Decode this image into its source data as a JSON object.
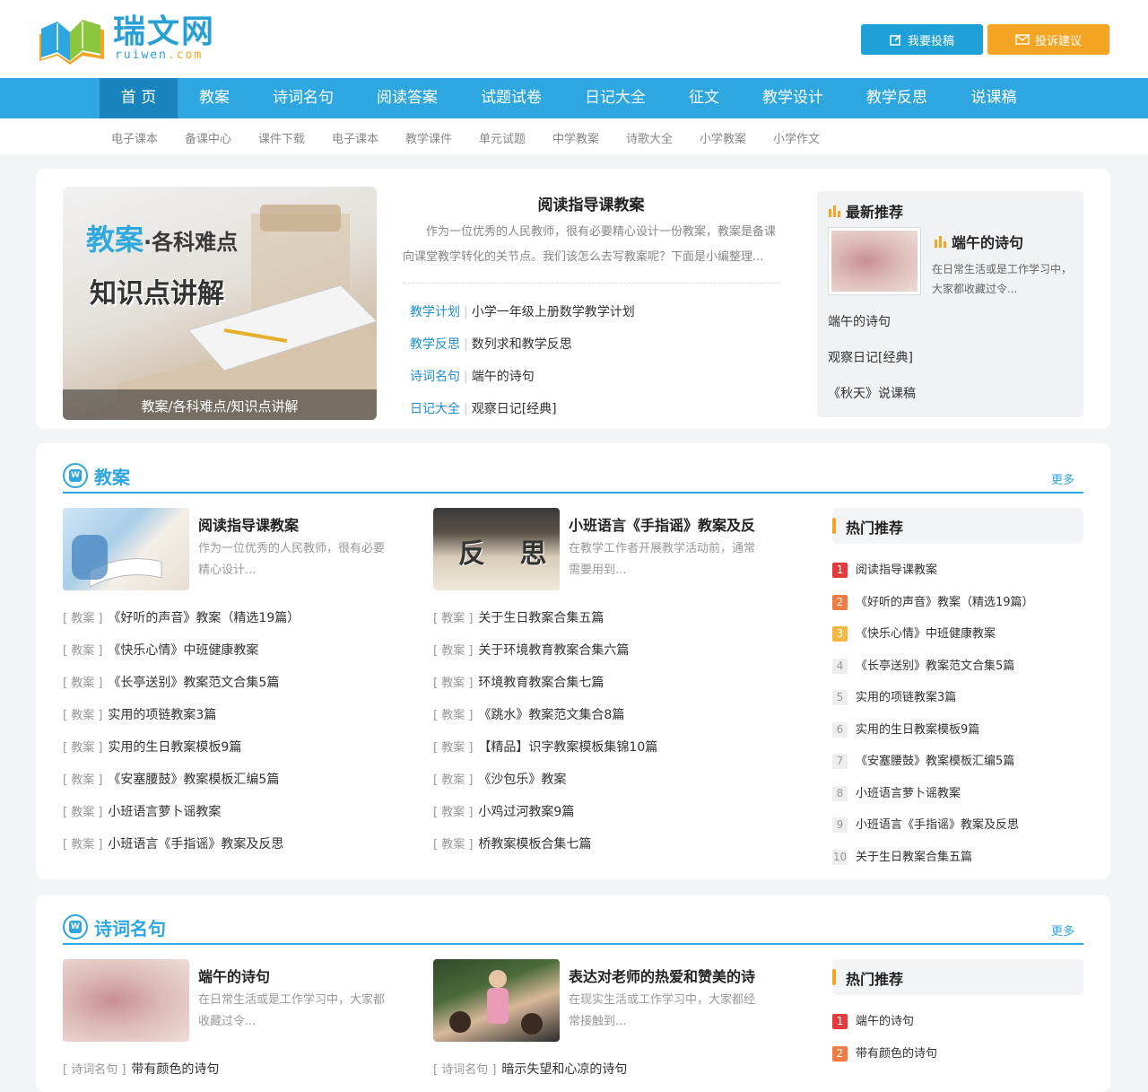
{
  "header": {
    "logo_cn": "瑞文网",
    "logo_en_a": "ruiwen",
    "logo_en_b": ".com",
    "submit_button": "我要投稿",
    "complaint_button": "投诉建议"
  },
  "nav": [
    "首 页",
    "教案",
    "诗词名句",
    "阅读答案",
    "试题试卷",
    "日记大全",
    "征文",
    "教学设计",
    "教学反思",
    "说课稿"
  ],
  "subnav": [
    "电子课本",
    "备课中心",
    "课件下载",
    "电子课本",
    "教学课件",
    "单元试题",
    "中学教案",
    "诗歌大全",
    "小学教案",
    "小学作文"
  ],
  "hero": {
    "img_title_a": "教案",
    "img_title_b": "·各科难点",
    "img_title_c": "知识点讲解",
    "caption": "教案/各科难点/知识点讲解",
    "title": "阅读指导课教案",
    "desc": "作为一位优秀的人民教师，很有必要精心设计一份教案，教案是备课向课堂教学转化的关节点。我们该怎么去写教案呢？下面是小编整理...",
    "links": [
      {
        "cat": "教学计划",
        "title": "小学一年级上册数学教学计划"
      },
      {
        "cat": "教学反思",
        "title": "数列求和教学反思"
      },
      {
        "cat": "诗词名句",
        "title": "端午的诗句"
      },
      {
        "cat": "日记大全",
        "title": "观察日记[经典]"
      }
    ]
  },
  "recommend": {
    "heading": "最新推荐",
    "featured_title": "端午的诗句",
    "featured_desc": "在日常生活或是工作学习中，大家都收藏过令...",
    "links": [
      "端午的诗句",
      "观察日记[经典]",
      "《秋天》说课稿"
    ]
  },
  "section1": {
    "title": "教案",
    "more": "更多",
    "feat1": {
      "title": "阅读指导课教案",
      "desc": "作为一位优秀的人民教师，很有必要精心设计..."
    },
    "feat2": {
      "title": "小班语言《手指谣》教案及反",
      "desc": "在教学工作者开展教学活动前，通常需要用到...",
      "img_text": "反 思"
    },
    "tag": "[ 教案 ]",
    "left": [
      "《好听的声音》教案（精选19篇）",
      "《快乐心情》中班健康教案",
      "《长亭送别》教案范文合集5篇",
      "实用的项链教案3篇",
      "实用的生日教案模板9篇",
      "《安塞腰鼓》教案模板汇编5篇",
      "小班语言萝卜谣教案",
      "小班语言《手指谣》教案及反思"
    ],
    "right": [
      "关于生日教案合集五篇",
      "关于环境教育教案合集六篇",
      "环境教育教案合集七篇",
      "《跳水》教案范文集合8篇",
      "【精品】识字教案模板集锦10篇",
      "《沙包乐》教案",
      "小鸡过河教案9篇",
      "桥教案模板合集七篇"
    ],
    "hot_title": "热门推荐",
    "hot": [
      "阅读指导课教案",
      "《好听的声音》教案（精选19篇）",
      "《快乐心情》中班健康教案",
      "《长亭送别》教案范文合集5篇",
      "实用的项链教案3篇",
      "实用的生日教案模板9篇",
      "《安塞腰鼓》教案模板汇编5篇",
      "小班语言萝卜谣教案",
      "小班语言《手指谣》教案及反思",
      "关于生日教案合集五篇"
    ]
  },
  "section2": {
    "title": "诗词名句",
    "more": "更多",
    "feat1": {
      "title": "端午的诗句",
      "desc": "在日常生活或是工作学习中，大家都收藏过令..."
    },
    "feat2": {
      "title": "表达对老师的热爱和赞美的诗",
      "desc": "在现实生活或工作学习中，大家都经常接触到..."
    },
    "tag": "[ 诗词名句 ]",
    "left": [
      "带有颜色的诗句"
    ],
    "right": [
      "暗示失望和心凉的诗句"
    ],
    "hot_title": "热门推荐",
    "hot": [
      "端午的诗句",
      "带有颜色的诗句"
    ]
  },
  "colors": {
    "primary": "#2ea6e0",
    "nav_active": "#1883bc",
    "orange": "#f4a523"
  }
}
